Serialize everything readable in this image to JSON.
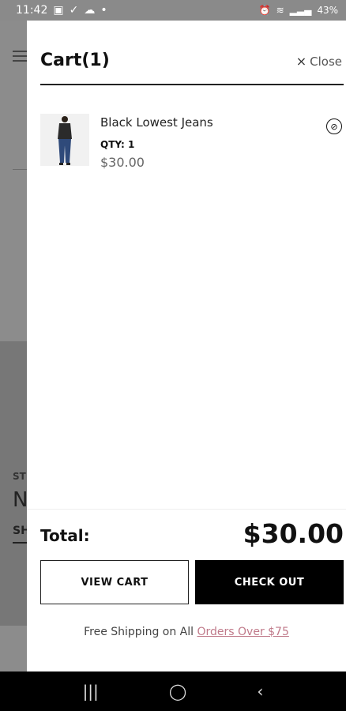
{
  "status_bar": {
    "time": "11:42",
    "battery": "43%"
  },
  "background": {
    "text_st": "ST",
    "text_n": "N",
    "text_sh": "SH"
  },
  "cart": {
    "title": "Cart(1)",
    "close_label": "Close",
    "items": [
      {
        "name": "Black Lowest Jeans",
        "qty_label": "QTY: 1",
        "price": "$30.00"
      }
    ],
    "total_label": "Total:",
    "total_value": "$30.00",
    "view_cart_label": "VIEW CART",
    "checkout_label": "CHECK OUT",
    "shipping_text": "Free Shipping on All ",
    "shipping_link": "Orders Over $75"
  },
  "nav": {
    "recents_icon": "recents-icon",
    "home_icon": "home-icon",
    "back_icon": "back-icon"
  }
}
